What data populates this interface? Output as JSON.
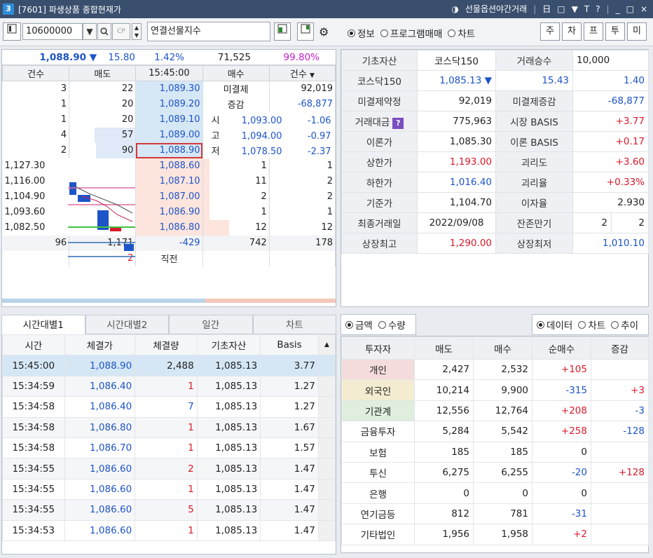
{
  "window": {
    "num": "3",
    "title": "[7601] 파생상품 종합현재가",
    "right_label": "선물옵션야간거래",
    "controls": [
      "日",
      "□",
      "▼",
      "T",
      "?",
      "_",
      "□",
      "×"
    ]
  },
  "toolbar": {
    "code": "10600000",
    "name": "연결선물지수",
    "tabs": [
      "주",
      "차",
      "프",
      "투",
      "미"
    ],
    "radios": [
      {
        "label": "정보",
        "on": true
      },
      {
        "label": "프로그램매매",
        "on": false
      },
      {
        "label": "차트",
        "on": false
      }
    ]
  },
  "orderbook": {
    "price": "1,088.90",
    "arrow": "▼",
    "change": "15.80",
    "pct": "1.42%",
    "volume": "71,525",
    "ratio": "99.80%",
    "headers": [
      "건수",
      "매도",
      "15:45:00",
      "매수",
      "건수"
    ],
    "asks": [
      {
        "cnt": "3",
        "qty": "22",
        "price": "1,089.30"
      },
      {
        "cnt": "1",
        "qty": "20",
        "price": "1,089.20"
      },
      {
        "cnt": "1",
        "qty": "20",
        "price": "1,089.10"
      },
      {
        "cnt": "4",
        "qty": "57",
        "price": "1,089.00"
      },
      {
        "cnt": "2",
        "qty": "90",
        "price": "1,088.90"
      }
    ],
    "ask_side": [
      {
        "label": "미결제",
        "value": "92,019"
      },
      {
        "label": "증감",
        "value": "-68,877"
      },
      {
        "label": "시",
        "value": "1,093.00",
        "diff": "-1.06"
      },
      {
        "label": "고",
        "value": "1,094.00",
        "diff": "-0.97"
      },
      {
        "label": "저",
        "value": "1,078.50",
        "diff": "-2.37"
      }
    ],
    "bids": [
      {
        "price": "1,088.60",
        "qty": "1",
        "cnt": "1"
      },
      {
        "price": "1,087.10",
        "qty": "11",
        "cnt": "2"
      },
      {
        "price": "1,087.00",
        "qty": "2",
        "cnt": "2"
      },
      {
        "price": "1,086.90",
        "qty": "1",
        "cnt": "1"
      },
      {
        "price": "1,086.80",
        "qty": "12",
        "cnt": "12"
      }
    ],
    "axis": [
      "1,127.30",
      "1,116.00",
      "1,104.90",
      "1,093.60",
      "1,082.50"
    ],
    "total": {
      "ask_cnt": "96",
      "ask_qty": "1,171",
      "diff": "-429",
      "bid_qty": "742",
      "bid_cnt": "178"
    },
    "last": {
      "ask": "2",
      "label": "직전"
    }
  },
  "info": [
    [
      {
        "l": "기초자산"
      },
      {
        "v": "코스닥150",
        "cls": "c"
      },
      {
        "l": "거래승수"
      },
      {
        "v": "10,000",
        "cls": "l",
        "span": 2
      }
    ],
    [
      {
        "l": "코스닥150"
      },
      {
        "v": "1,085.13 ▼",
        "cls": "r blue"
      },
      {
        "v": "15.43",
        "cls": "r blue"
      },
      {
        "v": "1.40",
        "cls": "r blue",
        "span": 2
      }
    ],
    [
      {
        "l": "미결제약정"
      },
      {
        "v": "92,019",
        "cls": "r"
      },
      {
        "l": "미결제증감"
      },
      {
        "v": "-68,877",
        "cls": "r blue",
        "span": 2
      }
    ],
    [
      {
        "l": "거래대금",
        "q": true
      },
      {
        "v": "775,963",
        "cls": "r"
      },
      {
        "l": "시장 BASIS"
      },
      {
        "v": "+3.77",
        "cls": "r red",
        "span": 2
      }
    ],
    [
      {
        "l": "이론가"
      },
      {
        "v": "1,085.30",
        "cls": "r"
      },
      {
        "l": "이론 BASIS"
      },
      {
        "v": "+0.17",
        "cls": "r red",
        "span": 2
      }
    ],
    [
      {
        "l": "상한가"
      },
      {
        "v": "1,193.00",
        "cls": "r red"
      },
      {
        "l": "괴리도"
      },
      {
        "v": "+3.60",
        "cls": "r red",
        "span": 2
      }
    ],
    [
      {
        "l": "하한가"
      },
      {
        "v": "1,016.40",
        "cls": "r blue"
      },
      {
        "l": "괴리율"
      },
      {
        "v": "+0.33%",
        "cls": "r red",
        "span": 2
      }
    ],
    [
      {
        "l": "기준가"
      },
      {
        "v": "1,104.70",
        "cls": "r"
      },
      {
        "l": "이자율"
      },
      {
        "v": "2.930",
        "cls": "r",
        "span": 2
      }
    ],
    [
      {
        "l": "최종거래일"
      },
      {
        "v": "2022/09/08",
        "cls": "c"
      },
      {
        "l": "잔존만기"
      },
      {
        "v": "2",
        "cls": "r"
      },
      {
        "v": "2",
        "cls": "r"
      }
    ],
    [
      {
        "l": "상장최고"
      },
      {
        "v": "1,290.00",
        "cls": "r red"
      },
      {
        "l": "상장최저"
      },
      {
        "v": "1,010.10",
        "cls": "r blue",
        "span": 2
      }
    ]
  ],
  "trades": {
    "tabs": [
      "시간대별1",
      "시간대별2",
      "일간",
      "차트"
    ],
    "headers": [
      "시간",
      "체결가",
      "체결량",
      "기초자산",
      "Basis"
    ],
    "rows": [
      [
        "15:45:00",
        "1,088.90",
        "2,488",
        "1,085.13",
        "3.77",
        "k"
      ],
      [
        "15:34:59",
        "1,086.40",
        "1",
        "1,085.13",
        "1.27",
        "r"
      ],
      [
        "15:34:58",
        "1,086.40",
        "7",
        "1,085.13",
        "1.27",
        "b"
      ],
      [
        "15:34:58",
        "1,086.80",
        "1",
        "1,085.13",
        "1.67",
        "r"
      ],
      [
        "15:34:58",
        "1,086.70",
        "1",
        "1,085.13",
        "1.57",
        "r"
      ],
      [
        "15:34:55",
        "1,086.60",
        "2",
        "1,085.13",
        "1.47",
        "r"
      ],
      [
        "15:34:55",
        "1,086.60",
        "1",
        "1,085.13",
        "1.47",
        "r"
      ],
      [
        "15:34:55",
        "1,086.60",
        "5",
        "1,085.13",
        "1.47",
        "r"
      ],
      [
        "15:34:53",
        "1,086.60",
        "1",
        "1,085.13",
        "1.47",
        "r"
      ]
    ]
  },
  "investor": {
    "radios_left": [
      {
        "label": "금액",
        "on": true
      },
      {
        "label": "수량",
        "on": false
      }
    ],
    "radios_right": [
      {
        "label": "데이터",
        "on": true
      },
      {
        "label": "차트",
        "on": false
      },
      {
        "label": "추이",
        "on": false
      }
    ],
    "headers": [
      "투자자",
      "매도",
      "매수",
      "순매수",
      "증감"
    ],
    "rows": [
      {
        "name": "개인",
        "bg": "#f5dcdc",
        "sell": "2,427",
        "buy": "2,532",
        "net": "+105",
        "netc": "red",
        "chg": "",
        "chgc": ""
      },
      {
        "name": "외국인",
        "bg": "#f3ecd0",
        "sell": "10,214",
        "buy": "9,900",
        "net": "-315",
        "netc": "blue",
        "chg": "+3",
        "chgc": "red"
      },
      {
        "name": "기관계",
        "bg": "#dfeedd",
        "sell": "12,556",
        "buy": "12,764",
        "net": "+208",
        "netc": "red",
        "chg": "-3",
        "chgc": "blue"
      },
      {
        "name": "금융투자",
        "bg": "",
        "sell": "5,284",
        "buy": "5,542",
        "net": "+258",
        "netc": "red",
        "chg": "-128",
        "chgc": "blue"
      },
      {
        "name": "보험",
        "bg": "",
        "sell": "185",
        "buy": "185",
        "net": "0",
        "netc": "",
        "chg": "",
        "chgc": ""
      },
      {
        "name": "투신",
        "bg": "",
        "sell": "6,275",
        "buy": "6,255",
        "net": "-20",
        "netc": "blue",
        "chg": "+128",
        "chgc": "red"
      },
      {
        "name": "은행",
        "bg": "",
        "sell": "0",
        "buy": "0",
        "net": "0",
        "netc": "",
        "chg": "",
        "chgc": ""
      },
      {
        "name": "연기금등",
        "bg": "",
        "sell": "812",
        "buy": "781",
        "net": "-31",
        "netc": "blue",
        "chg": "",
        "chgc": ""
      },
      {
        "name": "기타법인",
        "bg": "",
        "sell": "1,956",
        "buy": "1,958",
        "net": "+2",
        "netc": "red",
        "chg": "",
        "chgc": ""
      }
    ]
  }
}
